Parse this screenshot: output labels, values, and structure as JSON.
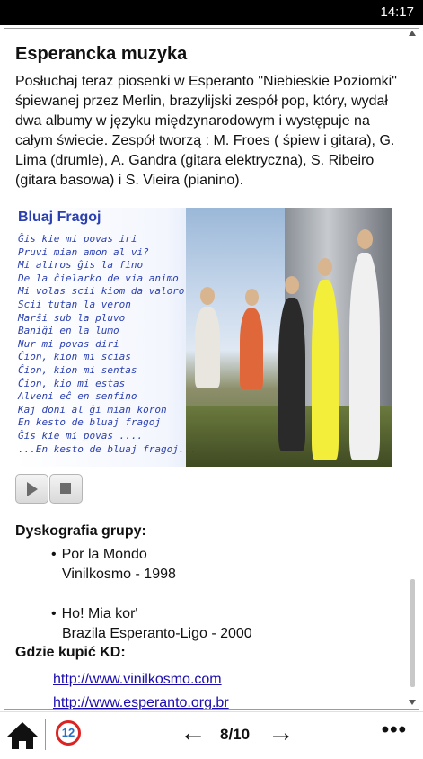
{
  "status_bar": {
    "time": "14:17"
  },
  "article": {
    "title": "Esperancka muzyka",
    "intro": "Posłuchaj teraz piosenki  w  Esperanto  \"Niebieskie Poziomki\"  śpiewanej przez Merlin, brazylijski zespół pop, który,  wydał dwa albumy w języku międzynarodowym  i występuje na całym świecie. Zespół tworzą : M. Froes ( śpiew i gitara), G. Lima (drumle), A. Gandra (gitara elektryczna), S. Ribeiro (gitara basowa) i S. Vieira (pianino).",
    "album_image": {
      "title": "Bluaj Fragoj",
      "lyrics": [
        "Ĝis kie mi povas iri",
        "Pruvi mian amon al vi?",
        "Mi aliros ĝis la fino",
        "De la ĉielarko de via animo",
        "Mi volas scii kiom da valoro",
        "Scii tutan la veron",
        "Marŝi sub la pluvo",
        "Baniĝi en la lumo",
        "Nur mi povas diri",
        "Ĉion, kion mi scias",
        "Ĉion, kion mi sentas",
        "Ĉion, kio mi estas",
        "Alveni eĉ en senfino",
        "Kaj doni al ĝi mian koron",
        "En kesto de bluaj fragoj",
        "Ĝis kie mi povas ....",
        "...En kesto de bluaj fragoj..."
      ]
    },
    "discography_heading": "Dyskografia grupy:",
    "discography": [
      {
        "title": "Por la Mondo",
        "detail": "Vinilkosmo - 1998"
      },
      {
        "title": "Ho! Mia kor'",
        "detail": "Brazila Esperanto-Ligo - 2000"
      }
    ],
    "buy_heading": "Gdzie kupić KD:",
    "links": [
      "http://www.vinilkosmo.com",
      "http://www.esperanto.org.br"
    ]
  },
  "bottom_nav": {
    "badge_number": "12",
    "page_indicator": "8/10",
    "prev_glyph": "←",
    "next_glyph": "→",
    "more_glyph": "•••"
  }
}
